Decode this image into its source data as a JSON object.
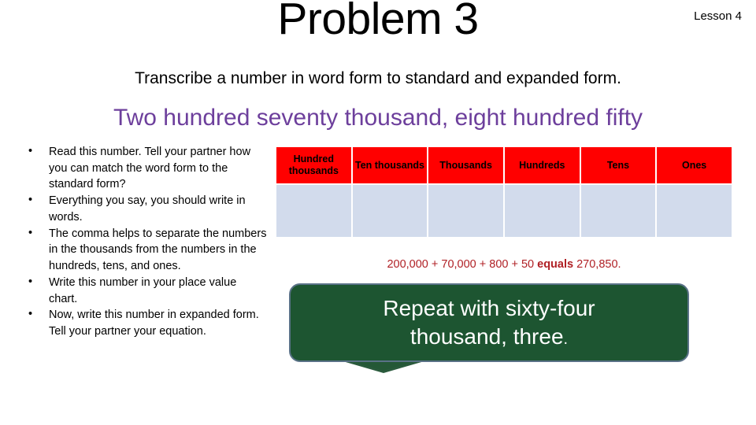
{
  "header": {
    "title": "Problem 3",
    "lesson_label": "Lesson 4",
    "subtitle": "Transcribe a number in word form to standard and expanded form.",
    "number_word_form": "Two hundred seventy thousand, eight hundred fifty",
    "number_word_form_color": "#6d3f9c"
  },
  "instructions": {
    "bullet_marker": "•",
    "items": [
      "Read this number.  Tell your partner how you can match the word form to the standard form?",
      " Everything you say, you should write in words.",
      "The comma helps to separate the numbers in the thousands from the numbers in the hundreds, tens, and ones.",
      "Write this number in your place value chart.",
      " Now, write this number in expanded form. Tell your partner your equation."
    ]
  },
  "place_value_chart": {
    "header_bg": "#ff0000",
    "cell_bg": "#d2dbec",
    "columns": [
      "Hundred thousands",
      "Ten thousands",
      "Thousands",
      "Hundreds",
      "Tens",
      "Ones"
    ],
    "rows": [
      [
        "",
        "",
        "",
        "",
        "",
        ""
      ]
    ]
  },
  "equation": {
    "color": "#b02025",
    "lead": "200,000 + 70,000 + 800 + 50 ",
    "operator_word": "equals",
    "trail": " 270,850."
  },
  "callout": {
    "line1": "Repeat with sixty-four",
    "line2": "thousand, three",
    "line2_period": ".",
    "bg_color": "#1d5531",
    "text_color": "#ffffff",
    "border_color": "#5a7287"
  }
}
